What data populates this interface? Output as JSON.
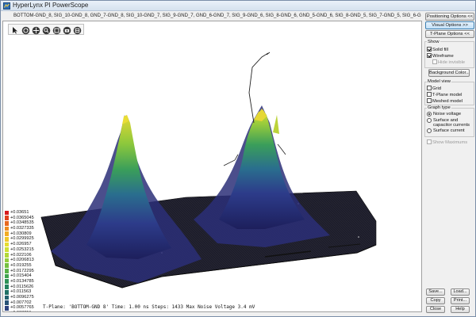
{
  "window": {
    "title": "HyperLynx PI PowerScope"
  },
  "layers_line": "BOTTOM-GND_8, SIG_10-GND_8, GND_7-GND_8, SIG_10-GND_7, SIG_9-GND_7, GND_6-GND_7, SIG_9-GND_6, SIG_8-GND_6, GND_5-GND_6, SIG_8-GND_5, SIG_7-GND_5, SIG_6-GND_5, PWR_4-GND_5, PWR_4-GND_7, SIG_6-",
  "toolbar": {
    "tools": [
      {
        "icon": "select-arrow-icon"
      },
      {
        "icon": "rotate-icon"
      },
      {
        "icon": "pan-icon"
      },
      {
        "icon": "zoom-icon"
      },
      {
        "icon": "zoom-extents-icon"
      },
      {
        "icon": "camera-icon"
      },
      {
        "icon": "copy-view-icon"
      }
    ]
  },
  "status_line": "T-Plane: 'BOTTOM-GND 8'  Time: 1.00 ns Steps: 1433  Max Noise Voltage 3.4 mV",
  "legend": {
    "items": [
      {
        "label": "+0.03651",
        "color": "#d7191c"
      },
      {
        "label": "+0.0365045",
        "color": "#e0401c"
      },
      {
        "label": "+0.0348535",
        "color": "#e8681d"
      },
      {
        "label": "+0.0327335",
        "color": "#ee8c1f"
      },
      {
        "label": "+0.030809",
        "color": "#f2ac24"
      },
      {
        "label": "+0.0299925",
        "color": "#f0c82a"
      },
      {
        "label": "+0.026957",
        "color": "#e6dc30"
      },
      {
        "label": "+0.0253215",
        "color": "#cfe034"
      },
      {
        "label": "+0.022106",
        "color": "#b2d838"
      },
      {
        "label": "+0.0206813",
        "color": "#93cd3c"
      },
      {
        "label": "+0.019255",
        "color": "#74c040"
      },
      {
        "label": "+0.0172295",
        "color": "#57b146"
      },
      {
        "label": "+0.015404",
        "color": "#3ea24e"
      },
      {
        "label": "+0.0134785",
        "color": "#2d9256"
      },
      {
        "label": "+0.0115626",
        "color": "#23825e"
      },
      {
        "label": "+0.011563",
        "color": "#207266"
      },
      {
        "label": "+0.0096275",
        "color": "#23626e"
      },
      {
        "label": "+0.007702",
        "color": "#285276"
      },
      {
        "label": "+0.0057765",
        "color": "#2d427e"
      },
      {
        "label": "+0.003851",
        "color": "#313386"
      },
      {
        "label": "+0.0019255",
        "color": "#35268e"
      },
      {
        "label": "+0 V",
        "color": "#381b96"
      }
    ]
  },
  "panel": {
    "positioning_options": "Positioning Options <<",
    "visual_options": "Visual Options >>",
    "tplane_options": "T-Plane Options <<",
    "show_label": "Show",
    "solid_fill": "Solid fill",
    "wireframe": "Wireframe",
    "hide_invisible": "Hide invisible",
    "background_color": "Background Color...",
    "model_view_label": "Model view",
    "grid": "Grid",
    "tplane_model": "T-Plane model",
    "meshed_model": "Meshed model",
    "graph_type_label": "Graph type",
    "noise_voltage": "Noise voltage",
    "surface_cap": "Surface and capacitor currents",
    "surface_current": "Surface current",
    "show_maximums": "Show Maximums",
    "save": "Save...",
    "load": "Load...",
    "copy": "Copy",
    "print": "Print...",
    "close": "Close",
    "help": "Help"
  }
}
